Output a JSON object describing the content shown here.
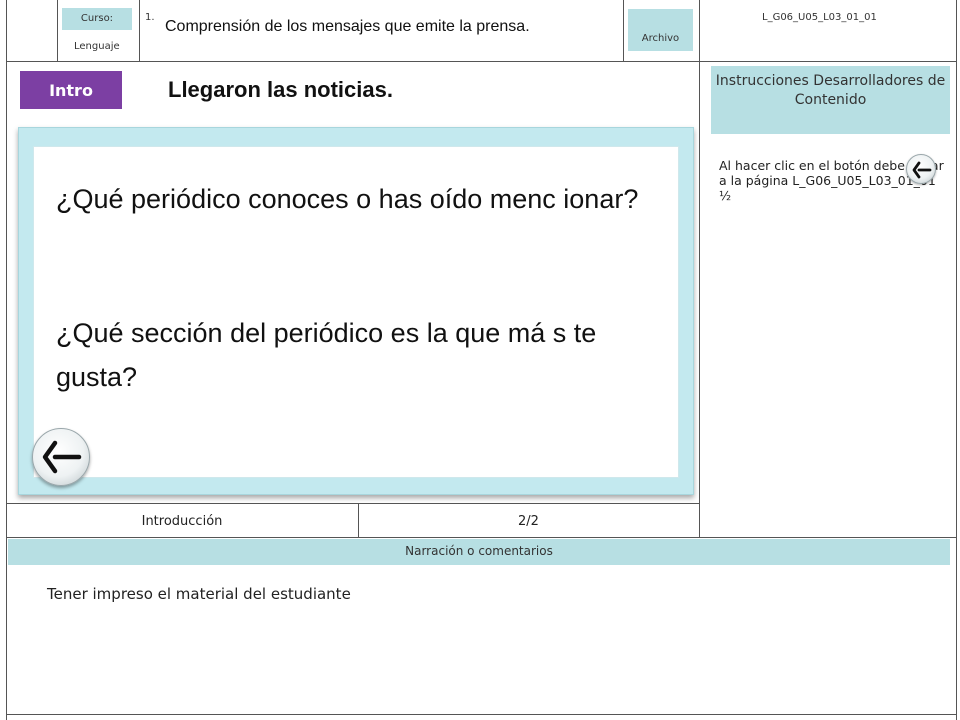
{
  "header": {
    "course_label": "Curso:",
    "course_value": "Lenguaje",
    "step_number": "1.",
    "title": "Comprensión de los mensajes que emite la prensa.",
    "archive_label": "Archivo",
    "code": "L_G06_U05_L03_01_01"
  },
  "slide": {
    "tag": "Intro",
    "title": "Llegaron las noticias.",
    "question_1": "¿Qué periódico conoces o has oído menc ionar?",
    "question_2": "¿Qué sección del periódico es la que má s te gusta?",
    "back_icon": "back-arrow-icon"
  },
  "instructions": {
    "heading": "Instrucciones Desarrolladores de Contenido",
    "text": "Al hacer clic en el botón debe llevar a la página L_G06_U05_L03_01_01 ½",
    "icon": "back-arrow-icon"
  },
  "footer": {
    "section": "Introducción",
    "page": "2/2"
  },
  "narration": {
    "heading": "Narración o comentarios",
    "text": "Tener impreso el material del estudiante"
  },
  "colors": {
    "accent_teal": "#b7dfe3",
    "tag_purple": "#7c3fa3",
    "card_border": "#c3e9ef"
  }
}
